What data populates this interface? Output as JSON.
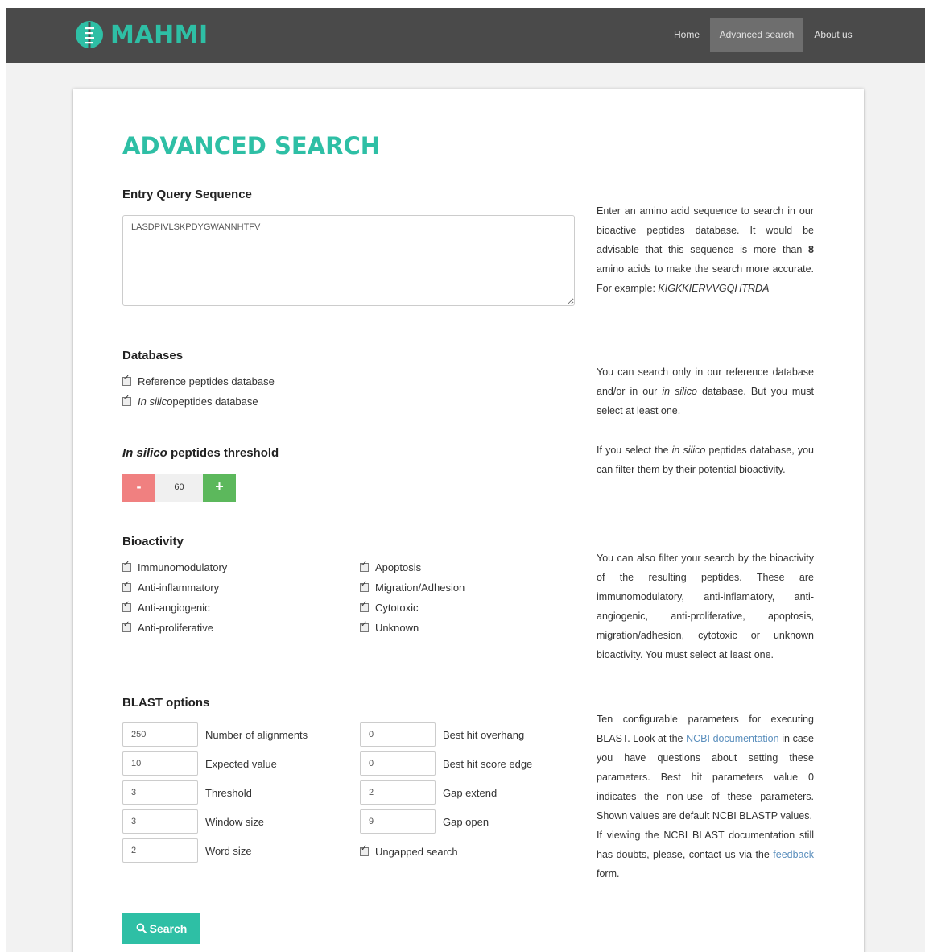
{
  "app": {
    "logo_text": "MAHMI"
  },
  "nav": {
    "home": "Home",
    "advanced_search": "Advanced search",
    "about_us": "About us"
  },
  "colors": {
    "accent": "#2ebfa5",
    "navbar": "#4a4a4a",
    "minus": "#f08080",
    "plus": "#5cb85c"
  },
  "page_title": "ADVANCED SEARCH",
  "query": {
    "title": "Entry Query Sequence",
    "value": "LASDPIVLSKPDYGWANNHTFV",
    "help_1": "Enter an amino acid sequence to search in our bioactive peptides database. It would be advisable that this sequence is more than ",
    "help_bold": "8",
    "help_2": " amino acids to make the search more accurate. For example: ",
    "help_example": "KIGKKIERVVGQHTRDA"
  },
  "databases": {
    "title": "Databases",
    "reference": "Reference peptides database",
    "insilico_em": "In silico",
    "insilico_rest": " peptides database",
    "help_1": "You can search only in our reference database and/or in our ",
    "help_em": "in silico",
    "help_2": " database. But you must select at least one."
  },
  "threshold": {
    "title_em": "In silico",
    "title_rest": " peptides threshold",
    "minus": "-",
    "value": "60",
    "plus": "+",
    "help_1": "If you select the ",
    "help_em": "in silico",
    "help_2": " peptides database, you can filter them by their potential bioactivity."
  },
  "bioactivity": {
    "title": "Bioactivity",
    "left": [
      "Immunomodulatory",
      "Anti-inflammatory",
      "Anti-angiogenic",
      "Anti-proliferative"
    ],
    "right": [
      "Apoptosis",
      "Migration/Adhesion",
      "Cytotoxic",
      "Unknown"
    ],
    "help": "You can also filter your search by the bioactivity of the resulting peptides. These are immunomodulatory, anti-inflamatory, anti-angiogenic, anti-proliferative, apoptosis, migration/adhesion, cytotoxic or unknown bioactivity. You must select at least one."
  },
  "blast": {
    "title": "BLAST options",
    "left": [
      {
        "value": "250",
        "label": "Number of alignments"
      },
      {
        "value": "10",
        "label": "Expected value"
      },
      {
        "value": "3",
        "label": "Threshold"
      },
      {
        "value": "3",
        "label": "Window size"
      },
      {
        "value": "2",
        "label": "Word size"
      }
    ],
    "right": [
      {
        "value": "0",
        "label": "Best hit overhang"
      },
      {
        "value": "0",
        "label": "Best hit score edge"
      },
      {
        "value": "2",
        "label": "Gap extend"
      },
      {
        "value": "9",
        "label": "Gap open"
      }
    ],
    "ungapped": "Ungapped search",
    "help_1": "Ten configurable parameters for executing BLAST. Look at the ",
    "help_link": "NCBI documentation",
    "help_2": " in case you have questions about setting these parameters. Best hit parameters value 0 indicates the non-use of these parameters. Shown values are default NCBI BLASTP values.",
    "help_3": "If viewing the NCBI BLAST documentation still has doubts, please, contact us via the ",
    "help_link2": "feedback",
    "help_4": " form."
  },
  "search_button": "Search"
}
